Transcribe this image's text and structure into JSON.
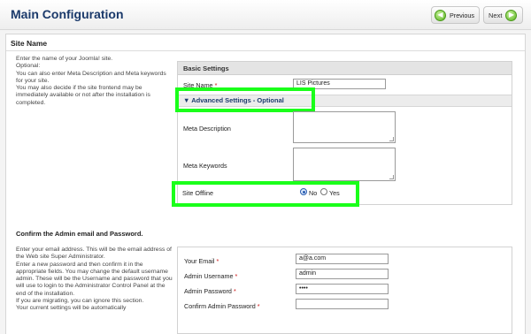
{
  "header": {
    "title": "Main Configuration",
    "previous_label": "Previous",
    "next_label": "Next"
  },
  "site_name_section": {
    "title": "Site Name",
    "description_lines": [
      "Enter the name of your Joomla! site.",
      "Optional:",
      "You can also enter Meta Description and Meta keywords for your site.",
      "You may also decide if the site frontend may be immediately available or not after the installation is completed."
    ],
    "basic_settings_heading": "Basic Settings",
    "site_name_label": "Site Name",
    "site_name_value": "LIS Pictures",
    "advanced_settings_label": "Advanced Settings - Optional",
    "meta_description_label": "Meta Description",
    "meta_keywords_label": "Meta Keywords",
    "site_offline_label": "Site Offline",
    "site_offline_options": [
      "No",
      "Yes"
    ],
    "site_offline_selected": "No"
  },
  "admin_section": {
    "title": "Confirm the Admin email and Password.",
    "description_lines": [
      "Enter your email address. This will be the email address of the Web site Super Administrator.",
      "Enter a new password and then confirm it in the appropriate fields. You may change the default username admin. These will be the Username and password that you will use to login to the Administrator Control Panel at the end of the installation.",
      "If you are migrating, you can ignore this section.",
      "Your current settings will be automatically"
    ],
    "email_label": "Your Email",
    "email_value": "a@a.com",
    "username_label": "Admin Username",
    "username_value": "admin",
    "password_label": "Admin Password",
    "password_value": "••••",
    "confirm_password_label": "Confirm Admin Password",
    "confirm_password_value": ""
  },
  "colors": {
    "title": "#1b3a6b",
    "highlight": "#1aff1a",
    "required": "#cc1111"
  }
}
